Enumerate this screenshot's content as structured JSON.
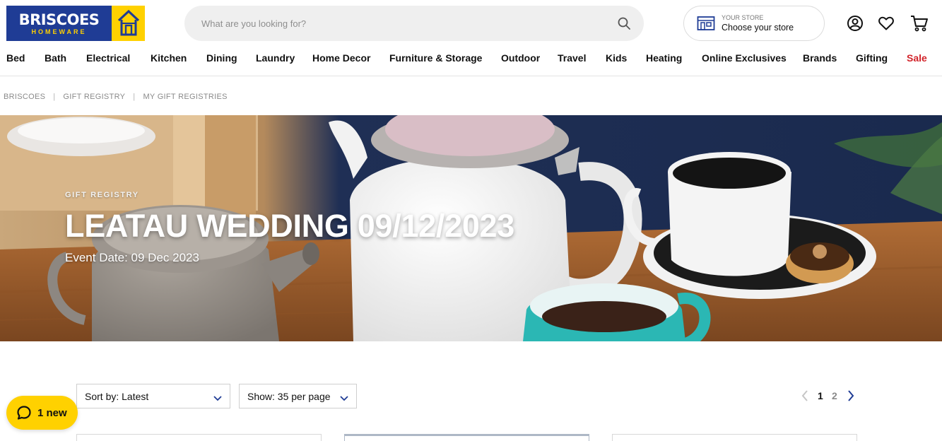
{
  "brand": {
    "name": "BRISCOES",
    "tagline": "HOMEWARE",
    "colors": {
      "blue": "#1f3c95",
      "yellow": "#ffd100",
      "sale_red": "#d2232a"
    }
  },
  "search": {
    "placeholder": "What are you looking for?",
    "icon": "search-icon"
  },
  "store": {
    "label_small": "YOUR STORE",
    "label_main": "Choose your store",
    "icon": "store-icon"
  },
  "header_icons": [
    "account-icon",
    "wishlist-heart-icon",
    "cart-icon"
  ],
  "nav": {
    "items": [
      "Bed",
      "Bath",
      "Electrical",
      "Kitchen",
      "Dining",
      "Laundry",
      "Home Decor",
      "Furniture & Storage",
      "Outdoor",
      "Travel",
      "Kids",
      "Heating",
      "Online Exclusives",
      "Brands",
      "Gifting",
      "Sale"
    ]
  },
  "breadcrumb": [
    "BRISCOES",
    "GIFT REGISTRY",
    "MY GIFT REGISTRIES"
  ],
  "hero": {
    "kicker": "GIFT REGISTRY",
    "title": "LEATAU WEDDING 09/12/2023",
    "event_date": "Event Date: 09 Dec 2023"
  },
  "toolbar": {
    "sort_label": "Sort by: Latest",
    "show_label": "Show: 35 per page"
  },
  "pagination": {
    "current": "1",
    "next_page": "2"
  },
  "chat": {
    "label": "1 new",
    "icon": "chat-bubble-icon"
  }
}
